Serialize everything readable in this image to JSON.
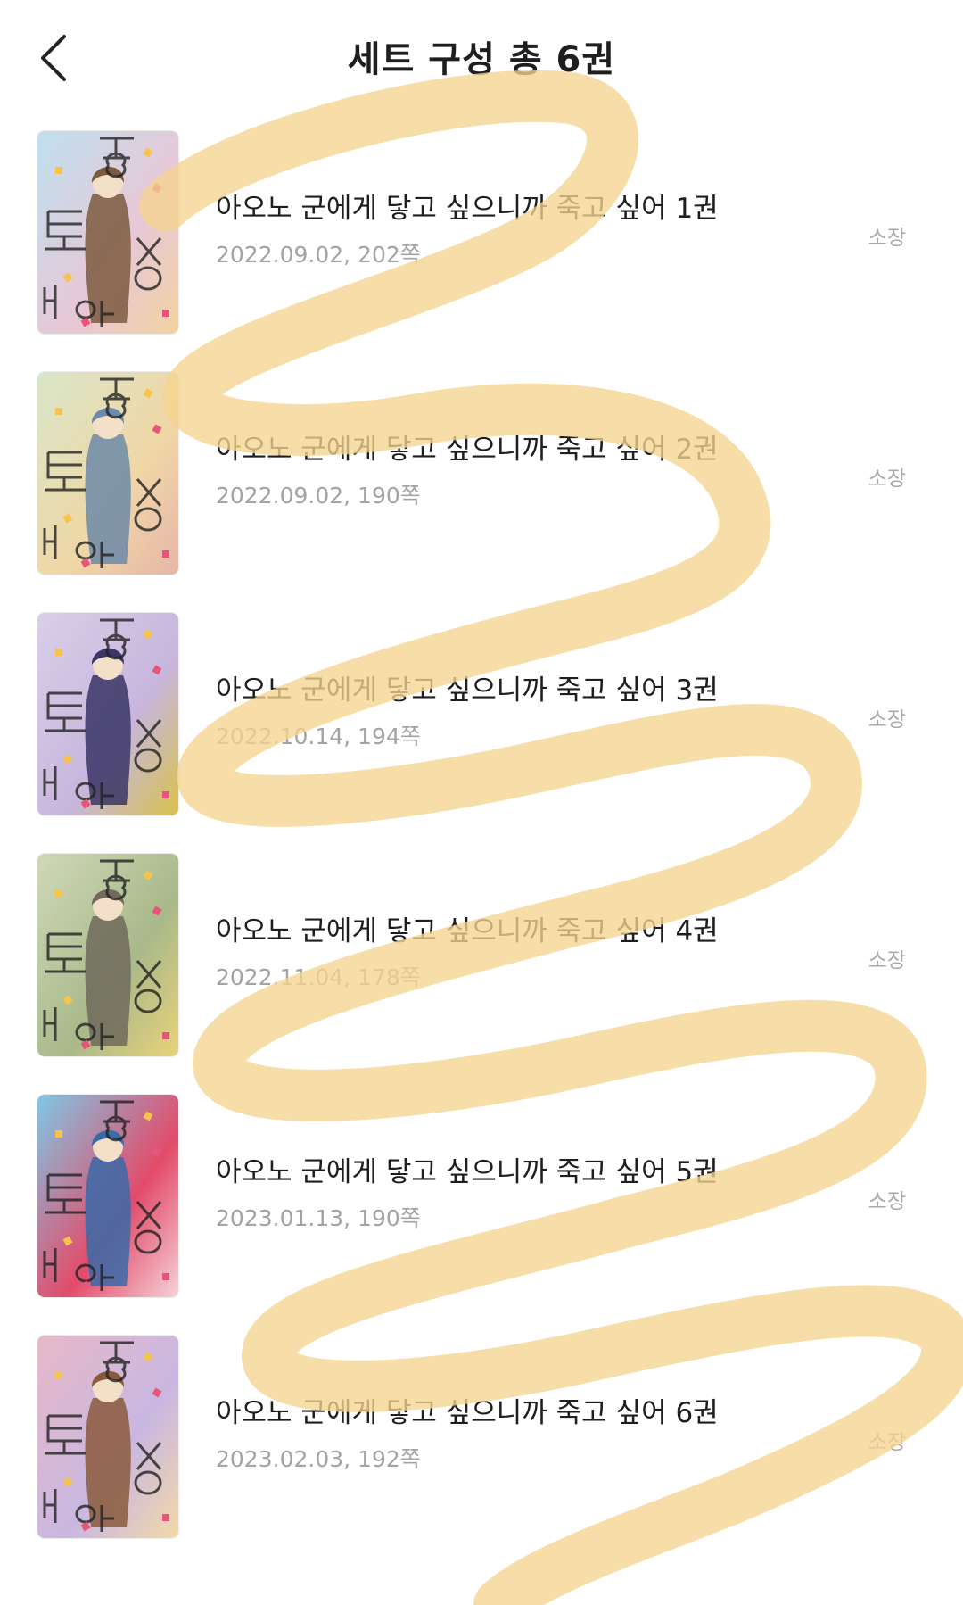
{
  "header": {
    "title": "세트 구성 총 6권"
  },
  "books": [
    {
      "title": "아오노 군에게 닿고 싶으니까 죽고 싶어 1권",
      "meta": "2022.09.02, 202쪽",
      "status": "소장",
      "cover_colors": [
        "#bfe0ef",
        "#e8c7d6",
        "#7c5a3e",
        "#f2d3a0"
      ]
    },
    {
      "title": "아오노 군에게 닿고 싶으니까 죽고 싶어 2권",
      "meta": "2022.09.02, 190쪽",
      "status": "소장",
      "cover_colors": [
        "#d9e6c9",
        "#f0d7a6",
        "#6d8aa8",
        "#e7b5a9"
      ]
    },
    {
      "title": "아오노 군에게 닿고 싶으니까 죽고 싶어 3권",
      "meta": "2022.10.14, 194쪽",
      "status": "소장",
      "cover_colors": [
        "#d8cfe8",
        "#c8b6dd",
        "#3a3566",
        "#d8c24a"
      ]
    },
    {
      "title": "아오노 군에게 닿고 싶으니까 죽고 싶어 4권",
      "meta": "2022.11.04, 178쪽",
      "status": "소장",
      "cover_colors": [
        "#cfd8b8",
        "#a9b98a",
        "#6f6a5c",
        "#e9d27a"
      ]
    },
    {
      "title": "아오노 군에게 닿고 싶으니까 죽고 싶어 5권",
      "meta": "2023.01.13, 190쪽",
      "status": "소장",
      "cover_colors": [
        "#7fc8e6",
        "#e34b6a",
        "#3a6aa8",
        "#f5d3d8"
      ]
    },
    {
      "title": "아오노 군에게 닿고 싶으니까 죽고 싶어 6권",
      "meta": "2023.02.03, 192쪽",
      "status": "소장",
      "cover_colors": [
        "#e7b9c8",
        "#c9b7e1",
        "#8a5a3c",
        "#f3d9a8"
      ]
    }
  ],
  "overlay": {
    "color": "#f5d48e",
    "opacity": 0.78
  },
  "icons": {
    "back": "chevron-left-icon"
  }
}
